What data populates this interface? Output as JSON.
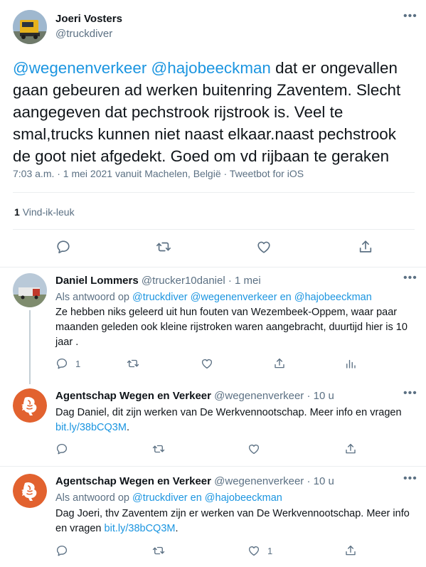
{
  "main_tweet": {
    "author_name": "Joeri Vosters",
    "author_handle": "@truckdiver",
    "mention1": "@wegenenverkeer",
    "mention2": "@hajobeeckman",
    "text_line1": "dat er ongevallen",
    "text_rest": "gaan gebeuren ad werken buitenring Zaventem. Slecht aangegeven dat pechstrook rijstrook is. Veel te smal,trucks kunnen niet naast elkaar.naast pechstrook de goot niet afgedekt. Goed om vd rijbaan te geraken",
    "meta": "7:03 a.m. · 1 mei 2021 vanuit Machelen, België · Tweetbot for iOS",
    "likes_count": "1",
    "likes_label": "Vind-ik-leuk"
  },
  "replies": [
    {
      "author_name": "Daniel Lommers",
      "author_handle": "@trucker10daniel",
      "time": "· 1 mei",
      "reply_prefix": "Als antwoord op",
      "reply_to1": "@truckdiver",
      "reply_to2": "@wegenenverkeer",
      "reply_en": "en",
      "reply_to3": "@hajobeeckman",
      "text": "Ze hebben niks geleerd uit hun fouten van Wezembeek-Oppem, waar paar maanden geleden ook kleine rijstroken waren aangebracht, duurtijd hier is 10 jaar .",
      "reply_count": "1"
    },
    {
      "author_name": "Agentschap Wegen en Verkeer",
      "author_handle": "@wegenenverkeer",
      "time": "· 10 u",
      "text": "Dag Daniel, dit zijn werken van De Werkvennootschap. Meer info en vragen",
      "link": "bit.ly/38bCQ3M",
      "link_suffix": "."
    },
    {
      "author_name": "Agentschap Wegen en Verkeer",
      "author_handle": "@wegenenverkeer",
      "time": "· 10 u",
      "reply_prefix": "Als antwoord op",
      "reply_to1": "@truckdiver",
      "reply_en": "en",
      "reply_to2": "@hajobeeckman",
      "text": "Dag Joeri, thv Zaventem zijn er werken van De Werkvennootschap. Meer info en vragen",
      "link": "bit.ly/38bCQ3M",
      "link_suffix": ".",
      "like_count": "1"
    }
  ],
  "colors": {
    "link": "#1b95e0",
    "muted": "#5b7083",
    "awv_orange": "#e2622f"
  },
  "icons": [
    "more-icon",
    "reply-icon",
    "retweet-icon",
    "like-icon",
    "share-icon",
    "analytics-icon",
    "awv-lion-logo"
  ]
}
